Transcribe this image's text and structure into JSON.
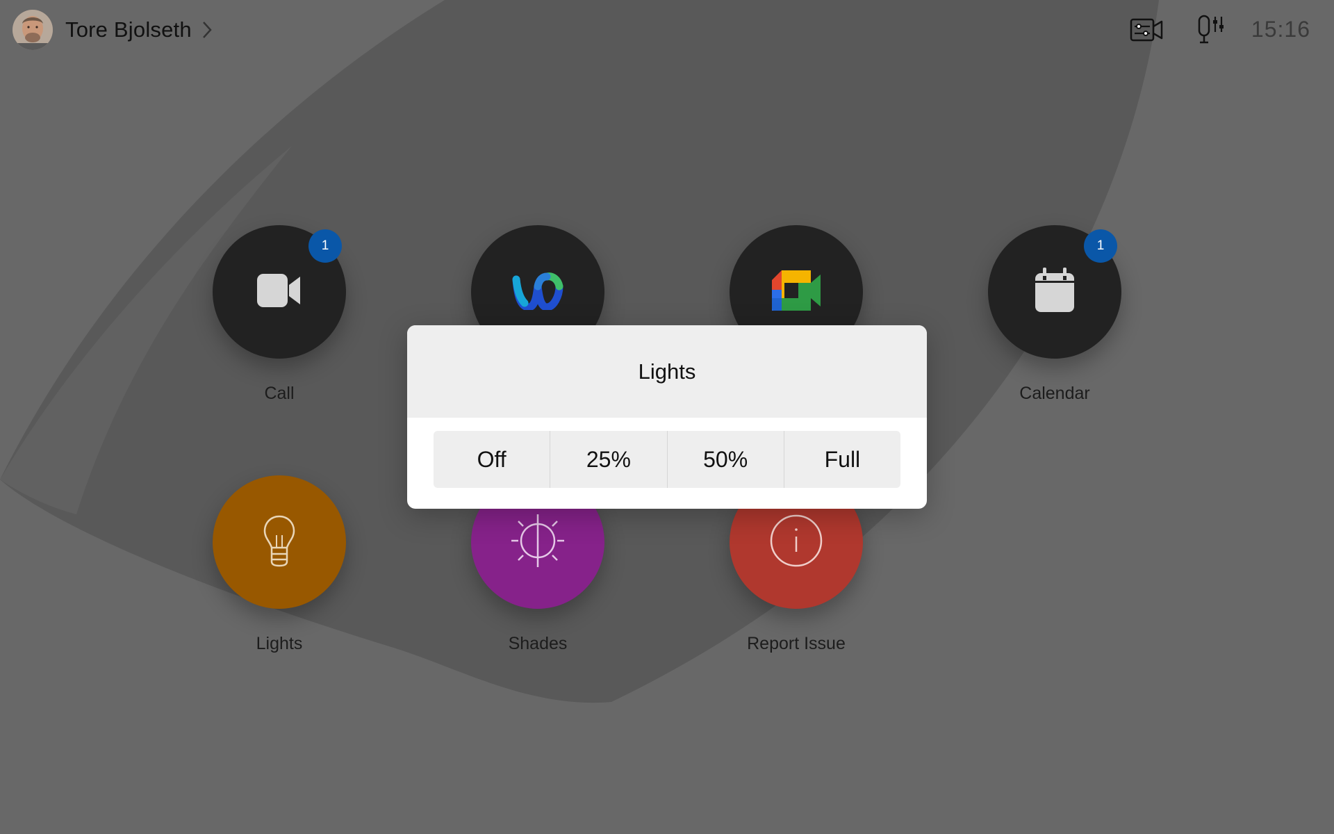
{
  "header": {
    "user_name": "Tore Bjolseth",
    "clock": "15:16",
    "icons": [
      "video-settings-icon",
      "microphone-settings-icon"
    ]
  },
  "apps": [
    {
      "label": "Call",
      "icon": "video-camera-icon",
      "color": "#222222",
      "badge": "1"
    },
    {
      "label": "",
      "icon": "webex-logo-icon",
      "color": "#222222",
      "badge": ""
    },
    {
      "label": "",
      "icon": "google-meet-logo-icon",
      "color": "#222222",
      "badge": ""
    },
    {
      "label": "Calendar",
      "icon": "calendar-icon",
      "color": "#222222",
      "badge": "1"
    },
    {
      "label": "Lights",
      "icon": "lightbulb-icon",
      "color": "#985800"
    },
    {
      "label": "Shades",
      "icon": "shades-icon",
      "color": "#86228a"
    },
    {
      "label": "Report Issue",
      "icon": "info-icon",
      "color": "#b0382e"
    }
  ],
  "modal": {
    "title": "Lights",
    "options": [
      "Off",
      "25%",
      "50%",
      "Full"
    ]
  },
  "colors": {
    "background": "#686868",
    "badge": "#0a57a8",
    "modal_header": "#eeeeee"
  }
}
